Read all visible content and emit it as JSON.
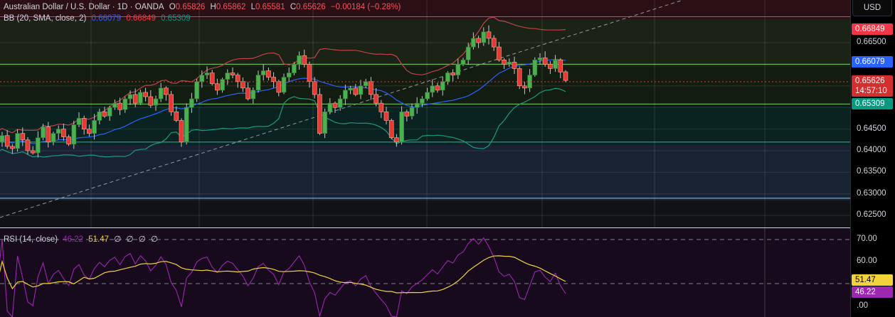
{
  "header": {
    "symbol": "Australian Dollar / U.S. Dollar · 1D · OANDA",
    "open_label": "O",
    "open": "0.65826",
    "high_label": "H",
    "high": "0.65862",
    "low_label": "L",
    "low": "0.65581",
    "close_label": "C",
    "close": "0.65626",
    "change": "−0.00184 (−0.28%)"
  },
  "bb_legend": {
    "label": "BB (20, SMA, close, 2)",
    "basis": "0.66079",
    "upper": "0.66849",
    "lower": "0.65309"
  },
  "rsi_legend": {
    "label": "RSI (14, close)",
    "rsi": "46.22",
    "ma": "51.47",
    "extra": [
      "∅",
      "∅",
      "∅",
      "∅"
    ]
  },
  "axis": {
    "currency_button": "USD",
    "price_ticks": [
      "0.66500",
      "0.64500",
      "0.64000",
      "0.63500",
      "0.63000",
      "0.62500"
    ],
    "price_tick_values": [
      0.665,
      0.645,
      0.64,
      0.635,
      0.63,
      0.625
    ],
    "rsi_ticks": [
      "70.00",
      "60.00",
      ".00"
    ],
    "tags": {
      "bb_upper": "0.66849",
      "bb_basis": "0.66079",
      "last_price": "0.65626",
      "countdown": "14:57:10",
      "bb_lower": "0.65309",
      "rsi_ma": "51.47",
      "rsi": "46.22"
    }
  },
  "colors": {
    "up": "#4caf50",
    "down": "#e53935",
    "bb_basis": "#2962ff",
    "bb_upper": "#c2414a",
    "bb_lower": "#1d9a7c",
    "rsi": "#9c27b0",
    "rsi_ma": "#f2d33b"
  },
  "chart_data": {
    "type": "candlestick",
    "price_range": [
      0.6225,
      0.671
    ],
    "horizontal_levels": [
      0.671,
      0.66,
      0.6508,
      0.642,
      0.629
    ],
    "closes": [
      0.642,
      0.6435,
      0.641,
      0.6405,
      0.644,
      0.6425,
      0.64,
      0.6395,
      0.643,
      0.6455,
      0.642,
      0.644,
      0.645,
      0.6432,
      0.6415,
      0.646,
      0.6475,
      0.645,
      0.644,
      0.647,
      0.649,
      0.648,
      0.65,
      0.651,
      0.6495,
      0.652,
      0.653,
      0.651,
      0.6535,
      0.6525,
      0.6505,
      0.652,
      0.6545,
      0.653,
      0.649,
      0.647,
      0.642,
      0.65,
      0.652,
      0.656,
      0.6575,
      0.658,
      0.6555,
      0.654,
      0.6565,
      0.658,
      0.6575,
      0.656,
      0.6545,
      0.652,
      0.654,
      0.6575,
      0.6585,
      0.657,
      0.656,
      0.6535,
      0.657,
      0.658,
      0.66,
      0.662,
      0.66,
      0.656,
      0.653,
      0.644,
      0.649,
      0.651,
      0.65,
      0.652,
      0.654,
      0.6545,
      0.653,
      0.655,
      0.656,
      0.653,
      0.651,
      0.649,
      0.647,
      0.643,
      0.642,
      0.649,
      0.648,
      0.65,
      0.651,
      0.652,
      0.6535,
      0.655,
      0.654,
      0.656,
      0.658,
      0.6575,
      0.66,
      0.661,
      0.664,
      0.666,
      0.665,
      0.6675,
      0.666,
      0.664,
      0.661,
      0.66,
      0.6605,
      0.659,
      0.655,
      0.6545,
      0.6575,
      0.661,
      0.6615,
      0.66,
      0.659,
      0.661,
      0.6582,
      0.65626
    ],
    "last_ohlc": {
      "o": 0.65826,
      "h": 0.65862,
      "l": 0.65581,
      "c": 0.65626
    },
    "rsi_levels": [
      70,
      50
    ],
    "rsi_range": [
      40,
      75
    ]
  }
}
